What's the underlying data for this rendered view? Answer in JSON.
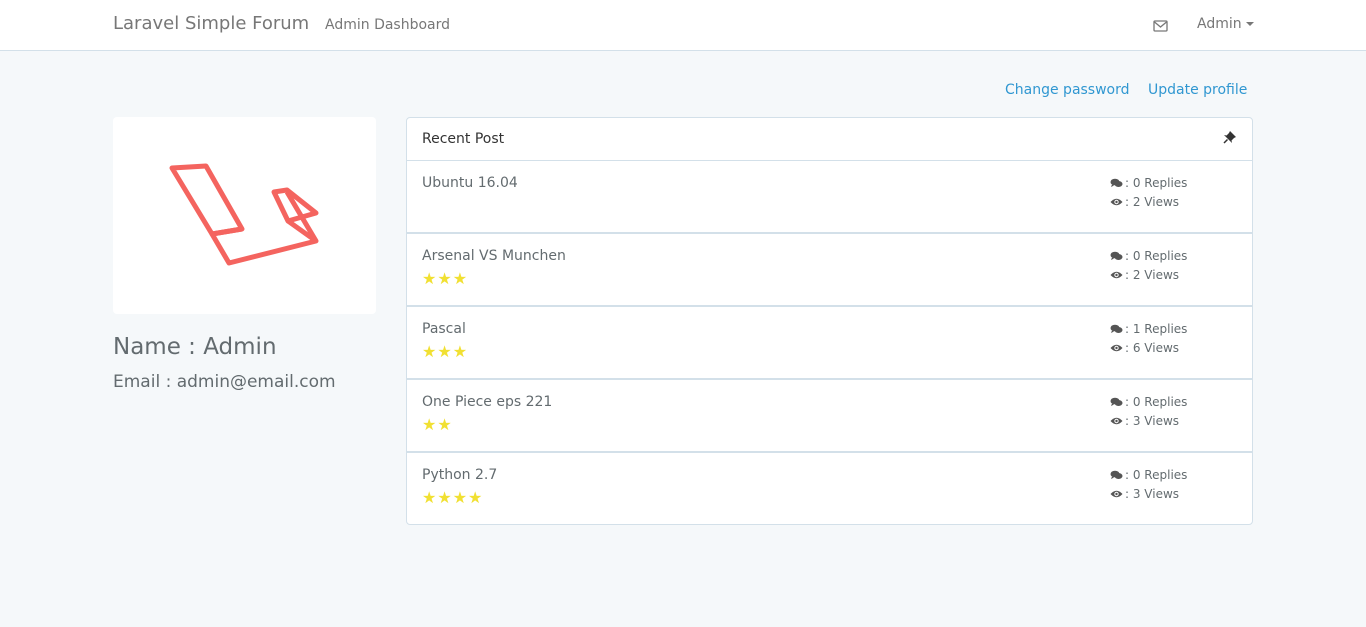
{
  "navbar": {
    "brand": "Laravel Simple Forum",
    "dashboard_link": "Admin Dashboard",
    "user_menu": "Admin",
    "icons": {
      "mail": "envelope-icon",
      "caret": "caret-down-icon"
    }
  },
  "profile_actions": {
    "change_password": "Change password",
    "update_profile": "Update profile"
  },
  "profile": {
    "avatar": "laravel-logo",
    "name": "Name : Admin",
    "email": "Email : admin@email.com"
  },
  "recent_posts": {
    "title": "Recent Post",
    "pin_icon": "pushpin-icon",
    "items": [
      {
        "title": "Ubuntu 16.04",
        "stars": 0,
        "replies": ": 0 Replies",
        "views": ": 2 Views"
      },
      {
        "title": "Arsenal VS Munchen",
        "stars": 3,
        "replies": ": 0 Replies",
        "views": ": 2 Views"
      },
      {
        "title": "Pascal",
        "stars": 3,
        "replies": ": 1 Replies",
        "views": ": 6 Views"
      },
      {
        "title": "One Piece eps 221",
        "stars": 2,
        "replies": ": 0 Replies",
        "views": ": 3 Views"
      },
      {
        "title": "Python 2.7",
        "stars": 4,
        "replies": ": 0 Replies",
        "views": ": 3 Views"
      }
    ]
  },
  "colors": {
    "link": "#3097d1",
    "star": "#f1e032",
    "logo": "#f4645f",
    "background": "#f5f8fa"
  }
}
